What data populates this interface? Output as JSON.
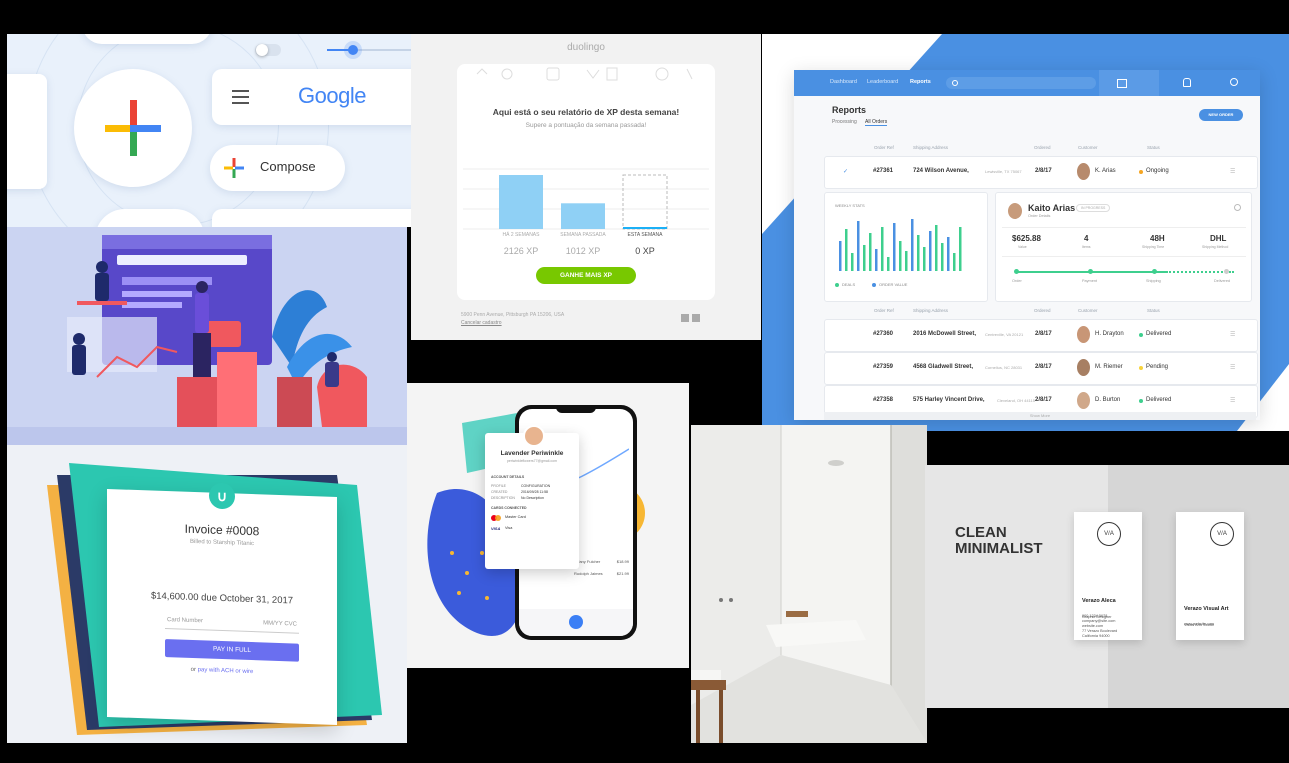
{
  "google": {
    "logo_text": "Google",
    "compose_label": "Compose",
    "colors": {
      "blue": "#4285f4",
      "red": "#ea4335",
      "yellow": "#fbbc05",
      "green": "#34a853"
    }
  },
  "duolingo": {
    "brand": "duolingo",
    "heading": "Aqui está o seu relatório de XP desta semana!",
    "subheading": "Supere a pontuação da semana passada!",
    "chart_data": {
      "type": "bar",
      "categories": [
        "HÁ 2 SEMANAS",
        "SEMANA PASSADA",
        "ESTA SEMANA"
      ],
      "values": [
        2126,
        1012,
        0
      ],
      "value_labels": [
        "2126 XP",
        "1012 XP",
        "0 XP"
      ]
    },
    "cta_label": "GANHE MAIS XP",
    "address": "5900 Penn Avenue, Pittsburgh PA 15206, USA",
    "unsubscribe": "Cancelar cadastro",
    "accent": "#78c800"
  },
  "dashboard": {
    "nav": [
      "Dashboard",
      "Leaderboard",
      "Reports"
    ],
    "title": "Reports",
    "tabs": [
      "Processing",
      "All Orders"
    ],
    "new_order_label": "NEW ORDER",
    "columns": [
      "Order Ref",
      "Shipping Address",
      "Ordered",
      "Customer",
      "Status"
    ],
    "rows": [
      {
        "ref": "#27361",
        "address": "724 Wilson Avenue,",
        "city": "Lewisville, TX 75067",
        "date": "2/8/17",
        "customer": "K. Arias",
        "status": "Ongoing",
        "color": "#f5a623"
      },
      {
        "ref": "#27360",
        "address": "2016 McDowell Street,",
        "city": "Centreville, VA 20121",
        "date": "2/8/17",
        "customer": "H. Drayton",
        "status": "Delivered",
        "color": "#3ecf8e"
      },
      {
        "ref": "#27359",
        "address": "4568 Gladwell Street,",
        "city": "Cornelius, NC 28031",
        "date": "2/8/17",
        "customer": "M. Riemer",
        "status": "Pending",
        "color": "#f8d33a"
      },
      {
        "ref": "#27358",
        "address": "575 Harley Vincent Drive,",
        "city": "Cleveland, OH 44115",
        "date": "2/8/17",
        "customer": "D. Burton",
        "status": "Delivered",
        "color": "#3ecf8e"
      }
    ],
    "weekly_stats_label": "WEEKLY STATS",
    "legend": [
      "DEALS",
      "ORDER VALUE"
    ],
    "detail": {
      "name": "Kaito Arias",
      "sub": "Order Details",
      "badge": "IN PROGRESS",
      "stats": [
        {
          "value": "$625.88",
          "label": "Value"
        },
        {
          "value": "4",
          "label": "Items"
        },
        {
          "value": "48H",
          "label": "Shipping Time"
        },
        {
          "value": "DHL",
          "label": "Shipping Method"
        }
      ],
      "steps": [
        "Order",
        "Payment",
        "Shipping",
        "Delivered"
      ]
    },
    "show_more": "Show More",
    "accent": "#4a90e2"
  },
  "invoice": {
    "title": "Invoice #0008",
    "billed": "Billed to Starship Titanic",
    "amount": "$14,600.00 due October 31, 2017",
    "card_placeholder": "Card Number",
    "expiry_placeholder": "MM/YY CVC",
    "pay_label": "PAY IN FULL",
    "alt_prefix": "or ",
    "alt_link": "pay with ACH or wire",
    "accent": "#2cc7b0"
  },
  "phone": {
    "name": "Lavender Periwinkle",
    "email": "periwinkleflowers77@gmail.com",
    "account_details": "ACCOUNT DETAILS",
    "fields": [
      {
        "k": "PROFILE",
        "v": "CONFIGURATION"
      },
      {
        "k": "CREATED",
        "v": "2016/09/28 11:58"
      },
      {
        "k": "DESCRIPTION",
        "v": "No Description"
      }
    ],
    "cards_label": "CARDS CONNECTED",
    "cards": [
      "Master Card",
      "Visa"
    ],
    "list": [
      {
        "name": "Tiffany Fulcher",
        "amount": "$18.99"
      },
      {
        "name": "Rudolph Jaimes",
        "amount": "$21.99"
      }
    ]
  },
  "cards": {
    "headline": [
      "CLEAN",
      "MINIMALIST"
    ],
    "monogram": "V/A",
    "left_name": "Verazo Aleca",
    "left_title": "Graphic Designer",
    "left_info": [
      "000 1234 5678",
      "company@site.com",
      "website.com",
      "",
      "77 Verazo Boulevard",
      "California 94000"
    ],
    "right_name": "Verazo Visual Art",
    "right_title": "Visual Arts Studio",
    "right_info": [
      "www.website.com"
    ]
  }
}
